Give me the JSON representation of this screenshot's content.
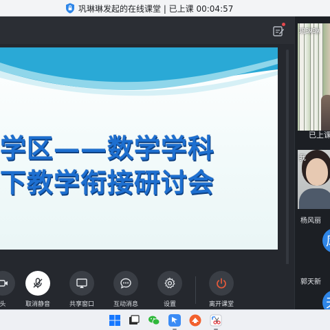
{
  "window": {
    "title": "巩琳琳发起的在线课堂 | 已上课 00:04:57"
  },
  "slide": {
    "title_line1": "学区——数学学科",
    "title_line2": "下教学衔接研讨会"
  },
  "toolbar": {
    "items": [
      {
        "label": "头",
        "icon": "camera-icon"
      },
      {
        "label": "取消静音",
        "icon": "mic-muted-icon"
      },
      {
        "label": "共享窗口",
        "icon": "screen-share-icon"
      },
      {
        "label": "互动消息",
        "icon": "chat-icon"
      },
      {
        "label": "设置",
        "icon": "gear-icon"
      },
      {
        "label": "离开课堂",
        "icon": "power-icon"
      }
    ]
  },
  "participants": {
    "host_name": "巩琳琳",
    "status": "已上课",
    "self_name": "我",
    "others": [
      {
        "name": "杨风丽",
        "avatar_char": "风"
      },
      {
        "name": "郭天新",
        "avatar_char": "天"
      }
    ]
  },
  "taskbar": {
    "icons": [
      "windows-start-icon",
      "desktop-icon",
      "wechat-icon",
      "dingtalk-icon",
      "app-orange-icon",
      "snipping-tool-icon"
    ]
  },
  "colors": {
    "accent": "#2f86e8",
    "leave": "#e85a3a",
    "slide_title": "#1d6fd0"
  }
}
